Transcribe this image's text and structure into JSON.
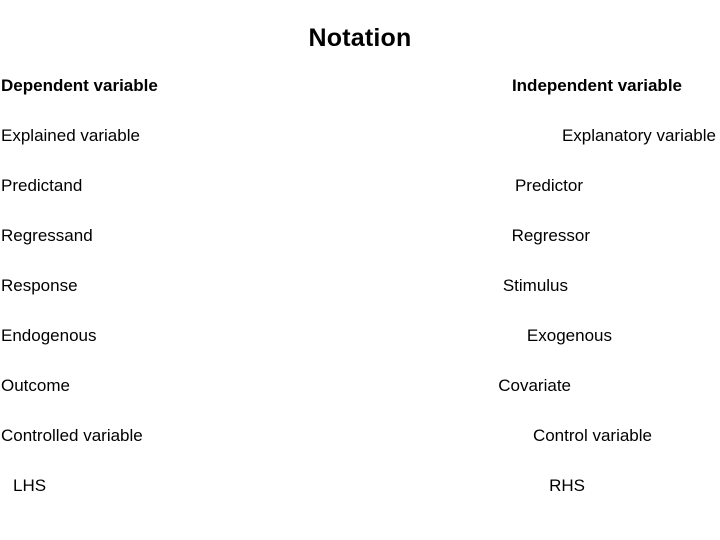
{
  "slide": {
    "title": "Notation",
    "background_color": "#ffffff",
    "text_color": "#000000"
  },
  "table": {
    "header": {
      "left": "Dependent variable",
      "right": "Independent variable"
    },
    "rows": [
      {
        "left": "Explained variable",
        "right": "Explanatory variable"
      },
      {
        "left": "Predictand",
        "right": "Predictor"
      },
      {
        "left": "Regressand",
        "right": "Regressor"
      },
      {
        "left": "Response",
        "right": "Stimulus"
      },
      {
        "left": "Endogenous",
        "right": "Exogenous"
      },
      {
        "left": "Outcome",
        "right": "Covariate"
      },
      {
        "left": "Controlled variable",
        "right": "Control variable"
      },
      {
        "left": "LHS",
        "right": "RHS"
      }
    ]
  }
}
